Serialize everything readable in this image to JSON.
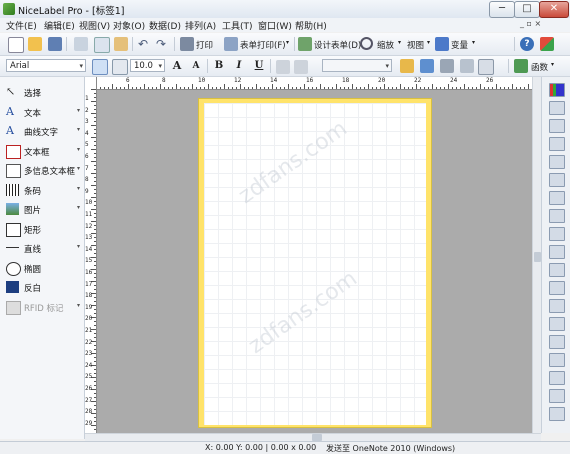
{
  "window": {
    "title": "NiceLabel Pro - [标签1]",
    "min": "─",
    "max": "□",
    "close": "✕"
  },
  "menu": [
    "文件(E)",
    "编辑(E)",
    "视图(V)",
    "对象(O)",
    "数据(D)",
    "排列(A)",
    "工具(T)",
    "窗口(W)",
    "帮助(H)"
  ],
  "toolbar1": {
    "print": "打印",
    "form_print": "表单打印(F)",
    "design_form": "设计表单(D)",
    "zoom": "缩放",
    "view": "视图",
    "variable": "变量"
  },
  "toolbar2": {
    "font": "Arial",
    "font_size": "10.0",
    "bold": "B",
    "italic": "I",
    "underline": "U",
    "functions": "函数"
  },
  "tools": [
    {
      "label": "选择",
      "icon": "pointer-icon",
      "dd": false
    },
    {
      "label": "文本",
      "icon": "text-icon",
      "dd": true
    },
    {
      "label": "曲线文字",
      "icon": "curve-text-icon",
      "dd": true
    },
    {
      "label": "文本框",
      "icon": "textbox-icon",
      "dd": true
    },
    {
      "label": "多信息文本框",
      "icon": "richtext-icon",
      "dd": true
    },
    {
      "label": "条码",
      "icon": "barcode-icon",
      "dd": true
    },
    {
      "label": "图片",
      "icon": "picture-icon",
      "dd": true
    },
    {
      "label": "矩形",
      "icon": "rectangle-icon",
      "dd": false
    },
    {
      "label": "直线",
      "icon": "line-icon",
      "dd": true
    },
    {
      "label": "椭圆",
      "icon": "ellipse-icon",
      "dd": false
    },
    {
      "label": "反白",
      "icon": "inverse-icon",
      "dd": false
    },
    {
      "label": "RFID 标记",
      "icon": "rfid-icon",
      "dd": true
    }
  ],
  "ruler_h": [
    "6",
    "8",
    "10",
    "12",
    "14",
    "16",
    "18",
    "20",
    "22",
    "24",
    "26"
  ],
  "ruler_v": [
    "1",
    "2",
    "3",
    "4",
    "5",
    "6",
    "7",
    "8",
    "9",
    "10",
    "11",
    "12",
    "13",
    "14",
    "15",
    "16",
    "17",
    "18",
    "19",
    "20",
    "21",
    "22",
    "23",
    "24",
    "25",
    "26",
    "27",
    "28",
    "29"
  ],
  "status": {
    "coords": "X: 0.00 Y: 0.00 | 0.00 x 0.00",
    "printer": "发送至 OneNote 2010 (Windows)"
  },
  "watermark": "zdfans.com",
  "colors": {
    "paper_border": "#ffe36a",
    "canvas_bg": "#ababab"
  }
}
